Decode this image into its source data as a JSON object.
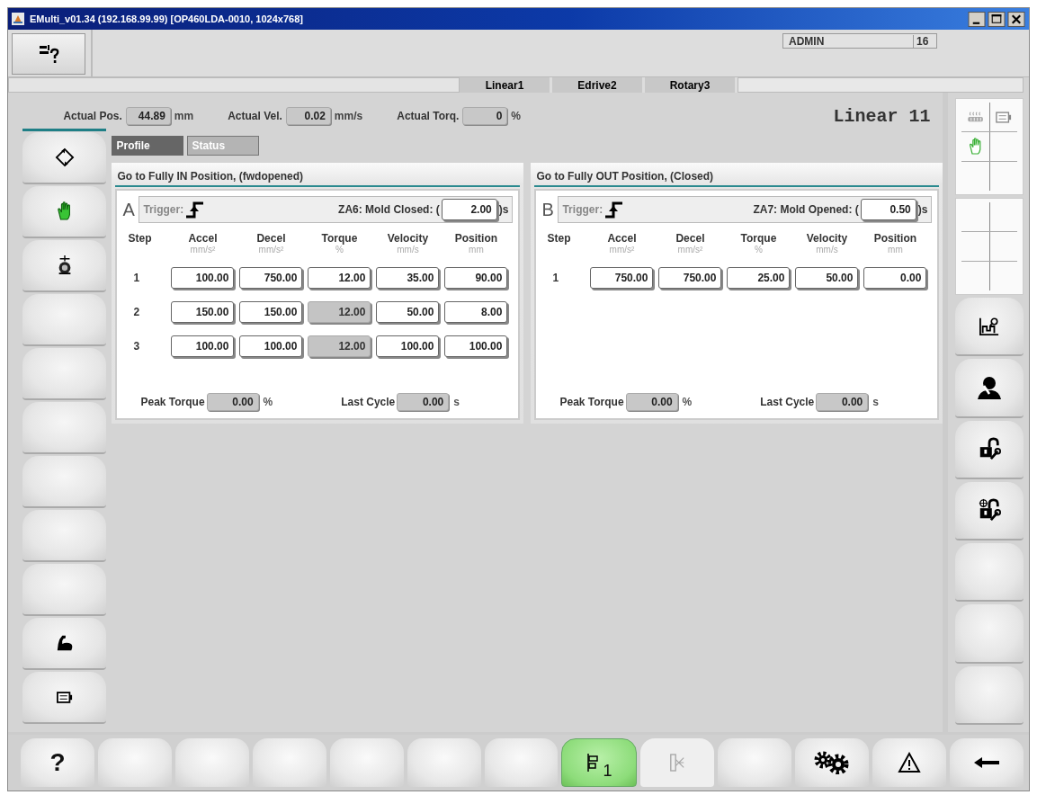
{
  "window": {
    "title": "EMulti_v01.34 (192.168.99.99) [OP460LDA-0010, 1024x768]"
  },
  "user": {
    "name": "ADMIN",
    "level": "16"
  },
  "axis_tabs": [
    {
      "label": "Linear1",
      "selected": false
    },
    {
      "label": "Edrive2",
      "selected": false
    },
    {
      "label": "Rotary3",
      "selected": false
    }
  ],
  "readouts": [
    {
      "label": "Actual Pos.",
      "value": "44.89",
      "unit": "mm"
    },
    {
      "label": "Actual Vel.",
      "value": "0.02",
      "unit": "mm/s"
    },
    {
      "label": "Actual Torq.",
      "value": "0",
      "unit": "%"
    }
  ],
  "axis_name": "Linear 11",
  "view_tabs": [
    {
      "label": "Profile",
      "selected": true
    },
    {
      "label": "Status",
      "selected": false
    }
  ],
  "left_buttons": [
    {
      "kind": "rotate"
    },
    {
      "kind": "hand"
    },
    {
      "kind": "motor"
    },
    {
      "kind": "blank"
    },
    {
      "kind": "blank"
    },
    {
      "kind": "blank"
    },
    {
      "kind": "blank"
    },
    {
      "kind": "blank"
    },
    {
      "kind": "blank"
    },
    {
      "kind": "arm"
    },
    {
      "kind": "battery"
    }
  ],
  "right_buttons": [
    {
      "kind": "chart"
    },
    {
      "kind": "person-wrench"
    },
    {
      "kind": "lock-wrench"
    },
    {
      "kind": "lock-target"
    },
    {
      "kind": "blank"
    },
    {
      "kind": "blank"
    },
    {
      "kind": "blank"
    }
  ],
  "panels": [
    {
      "title": "Go to Fully IN Position, (fwdopened)",
      "letter": "A",
      "trigger_label": "Trigger:",
      "timer_label": "ZA6: Mold Closed: (",
      "timer_value": "2.00",
      "timer_unit": ")s",
      "step_header": "Step",
      "columns": [
        {
          "name": "Accel",
          "unit": "mm/s²"
        },
        {
          "name": "Decel",
          "unit": "mm/s²"
        },
        {
          "name": "Torque",
          "unit": "%"
        },
        {
          "name": "Velocity",
          "unit": "mm/s"
        },
        {
          "name": "Position",
          "unit": "mm"
        }
      ],
      "rows": [
        {
          "step": "1",
          "cells": [
            {
              "value": "100.00",
              "disabled": false
            },
            {
              "value": "750.00",
              "disabled": false
            },
            {
              "value": "12.00",
              "disabled": false
            },
            {
              "value": "35.00",
              "disabled": false
            },
            {
              "value": "90.00",
              "disabled": false
            }
          ]
        },
        {
          "step": "2",
          "cells": [
            {
              "value": "150.00",
              "disabled": false
            },
            {
              "value": "150.00",
              "disabled": false
            },
            {
              "value": "12.00",
              "disabled": true
            },
            {
              "value": "50.00",
              "disabled": false
            },
            {
              "value": "8.00",
              "disabled": false
            }
          ]
        },
        {
          "step": "3",
          "cells": [
            {
              "value": "100.00",
              "disabled": false
            },
            {
              "value": "100.00",
              "disabled": false
            },
            {
              "value": "12.00",
              "disabled": true
            },
            {
              "value": "100.00",
              "disabled": false
            },
            {
              "value": "100.00",
              "disabled": false
            }
          ]
        }
      ],
      "peak_label": "Peak Torque",
      "peak_value": "0.00",
      "peak_unit": "%",
      "cycle_label": "Last Cycle",
      "cycle_value": "0.00",
      "cycle_unit": "s"
    },
    {
      "title": "Go to Fully OUT Position, (Closed)",
      "letter": "B",
      "trigger_label": "Trigger:",
      "timer_label": "ZA7: Mold Opened: (",
      "timer_value": "0.50",
      "timer_unit": ")s",
      "step_header": "Step",
      "columns": [
        {
          "name": "Accel",
          "unit": "mm/s²"
        },
        {
          "name": "Decel",
          "unit": "mm/s²"
        },
        {
          "name": "Torque",
          "unit": "%"
        },
        {
          "name": "Velocity",
          "unit": "mm/s"
        },
        {
          "name": "Position",
          "unit": "mm"
        }
      ],
      "rows": [
        {
          "step": "1",
          "cells": [
            {
              "value": "750.00",
              "disabled": false
            },
            {
              "value": "750.00",
              "disabled": false
            },
            {
              "value": "25.00",
              "disabled": false
            },
            {
              "value": "50.00",
              "disabled": false
            },
            {
              "value": "0.00",
              "disabled": false
            }
          ]
        }
      ],
      "peak_label": "Peak Torque",
      "peak_value": "0.00",
      "peak_unit": "%",
      "cycle_label": "Last Cycle",
      "cycle_value": "0.00",
      "cycle_unit": "s"
    }
  ],
  "bottom_buttons": [
    {
      "kind": "help",
      "label": "?",
      "selected": false,
      "disabled": false
    },
    {
      "kind": "blank",
      "selected": false,
      "disabled": false
    },
    {
      "kind": "blank",
      "selected": false,
      "disabled": false
    },
    {
      "kind": "blank",
      "selected": false,
      "disabled": false
    },
    {
      "kind": "blank",
      "selected": false,
      "disabled": false
    },
    {
      "kind": "blank",
      "selected": false,
      "disabled": false
    },
    {
      "kind": "blank",
      "selected": false,
      "disabled": false
    },
    {
      "kind": "axis",
      "label": "1",
      "selected": true,
      "disabled": false
    },
    {
      "kind": "nozzle",
      "selected": false,
      "disabled": true
    },
    {
      "kind": "blank",
      "selected": false,
      "disabled": false
    },
    {
      "kind": "gears",
      "selected": false,
      "disabled": false
    },
    {
      "kind": "alarm",
      "selected": false,
      "disabled": false
    },
    {
      "kind": "back",
      "selected": false,
      "disabled": false
    }
  ]
}
